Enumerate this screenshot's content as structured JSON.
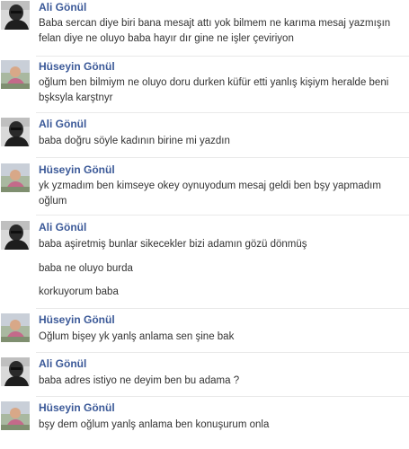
{
  "messages": [
    {
      "sender": "Ali Gönül",
      "avatar": "ali-avatar",
      "lines": [
        "Baba sercan diye biri bana mesajt attı yok bilmem ne karıma mesaj yazmışın felan diye ne oluyo baba hayır dır gine ne işler çeviriyon"
      ]
    },
    {
      "sender": "Hüseyin Gönül",
      "avatar": "huseyin-avatar",
      "lines": [
        "oğlum ben bilmiym ne oluyo doru durken küfür etti yanlış kişiym heralde beni bşksyla karştnyr"
      ]
    },
    {
      "sender": "Ali Gönül",
      "avatar": "ali-avatar",
      "lines": [
        "baba doğru söyle kadının birine mi yazdın"
      ]
    },
    {
      "sender": "Hüseyin Gönül",
      "avatar": "huseyin-avatar",
      "lines": [
        "yk yzmadım ben kimseye okey oynuyodum mesaj geldi ben bşy yapmadım oğlum"
      ]
    },
    {
      "sender": "Ali Gönül",
      "avatar": "ali-avatar",
      "lines": [
        "baba aşiretmiş bunlar sikecekler bizi adamın gözü dönmüş",
        "baba ne oluyo burda",
        "korkuyorum baba"
      ]
    },
    {
      "sender": "Hüseyin Gönül",
      "avatar": "huseyin-avatar",
      "lines": [
        "Oğlum bişey yk yanlş anlama sen şine bak"
      ]
    },
    {
      "sender": "Ali Gönül",
      "avatar": "ali-avatar",
      "lines": [
        "baba adres istiyo ne deyim ben bu adama ?"
      ]
    },
    {
      "sender": "Hüseyin Gönül",
      "avatar": "huseyin-avatar",
      "lines": [
        "bşy dem oğlum yanlş anlama ben konuşurum onla"
      ]
    }
  ],
  "colors": {
    "sender_name": "#3b5998",
    "message_text": "#333333",
    "separator": "#e9e9e9"
  }
}
